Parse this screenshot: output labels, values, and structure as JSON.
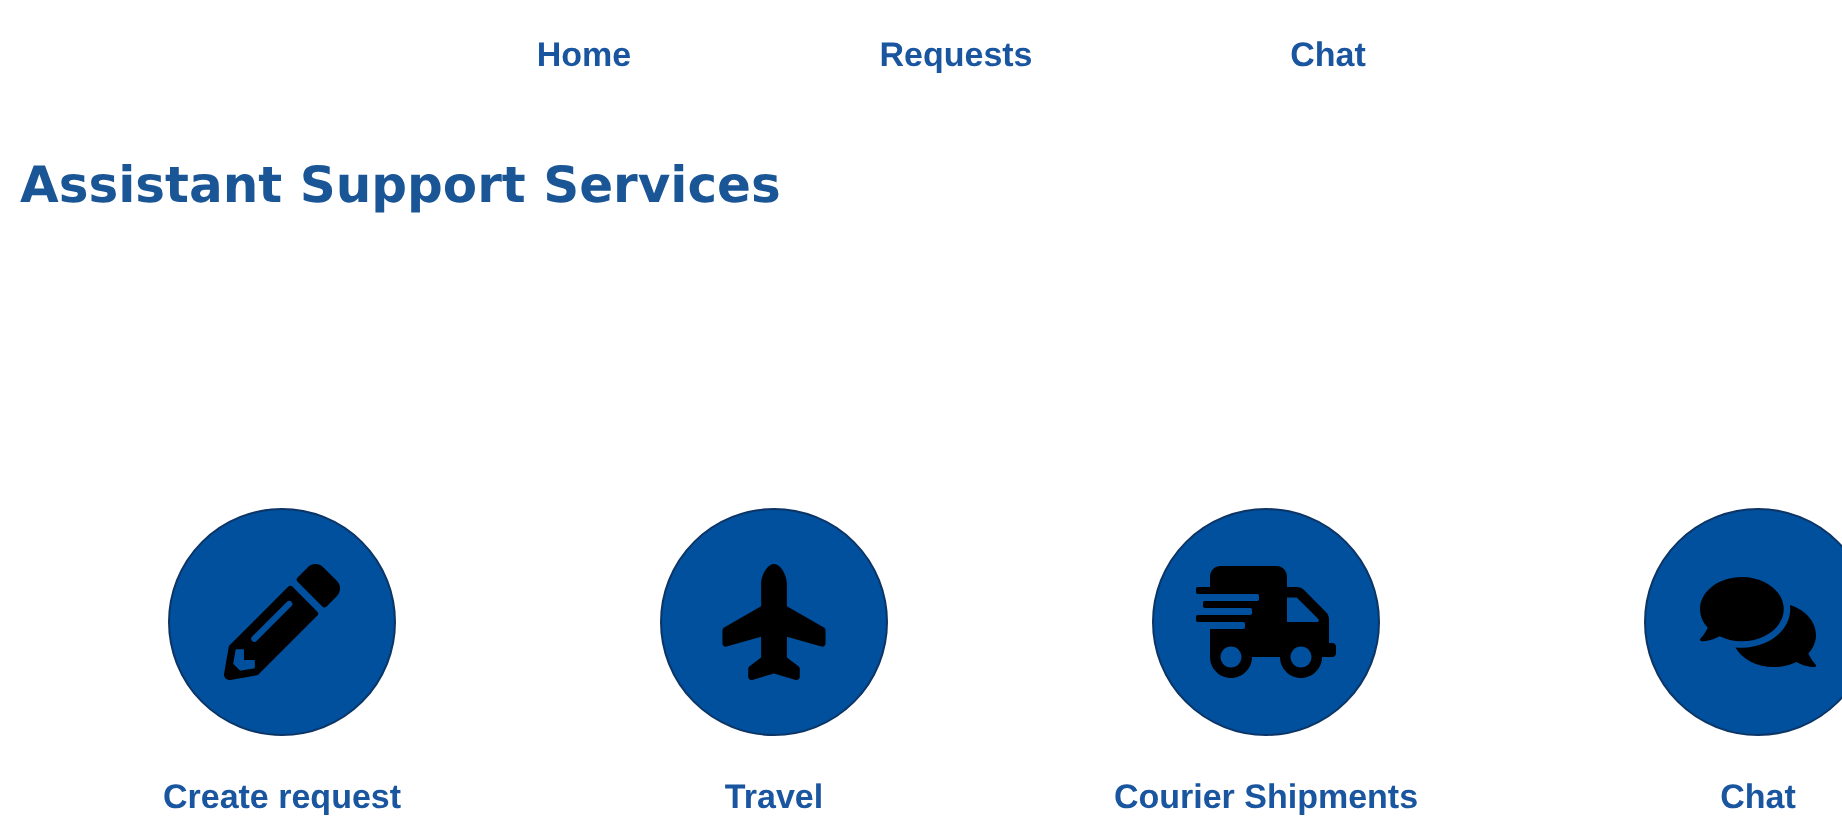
{
  "nav": [
    {
      "label": "Home"
    },
    {
      "label": "Requests"
    },
    {
      "label": "Chat"
    }
  ],
  "title": "Assistant Support Services",
  "services": [
    {
      "label": "Create request"
    },
    {
      "label": "Travel"
    },
    {
      "label": "Courier Shipments"
    },
    {
      "label": "Chat"
    }
  ]
}
